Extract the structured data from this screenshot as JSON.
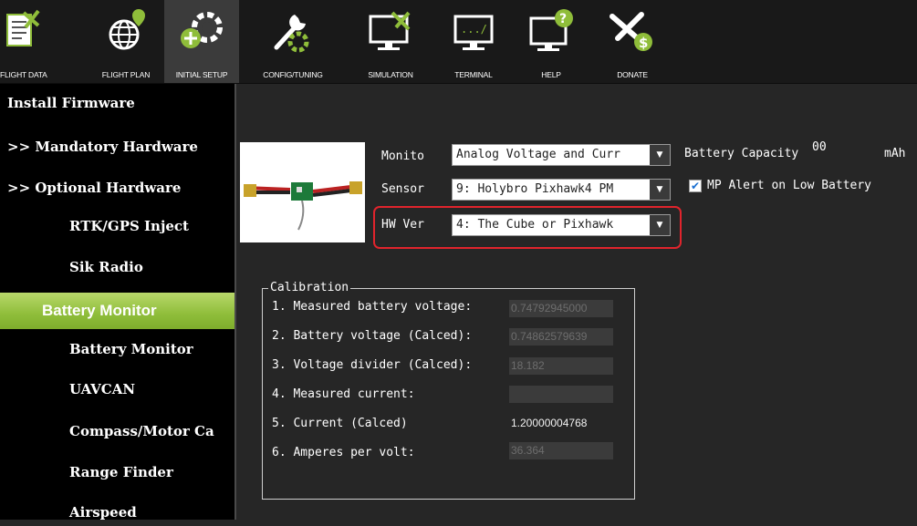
{
  "toolbar": {
    "buttons": [
      {
        "label": "FLIGHT DATA",
        "icon": "flight-data-icon"
      },
      {
        "label": "FLIGHT PLAN",
        "icon": "flight-plan-icon"
      },
      {
        "label": "INITIAL SETUP",
        "icon": "initial-setup-icon",
        "active": true
      },
      {
        "label": "CONFIG/TUNING",
        "icon": "config-tuning-icon"
      },
      {
        "label": "SIMULATION",
        "icon": "simulation-icon"
      },
      {
        "label": "TERMINAL",
        "icon": "terminal-icon"
      },
      {
        "label": "HELP",
        "icon": "help-icon"
      },
      {
        "label": "DONATE",
        "icon": "donate-icon"
      }
    ]
  },
  "sidebar": {
    "items": [
      {
        "label": "Install Firmware"
      },
      {
        "label": ">> Mandatory Hardware"
      },
      {
        "label": ">> Optional Hardware"
      },
      {
        "label": "RTK/GPS Inject"
      },
      {
        "label": "Sik Radio"
      },
      {
        "label": "Battery Monitor"
      },
      {
        "label": "Battery Monitor"
      },
      {
        "label": "UAVCAN"
      },
      {
        "label": "Compass/Motor Ca"
      },
      {
        "label": "Range Finder"
      },
      {
        "label": "Airspeed"
      }
    ]
  },
  "battery": {
    "monitor_label": "Monito",
    "monitor_value": "Analog Voltage and Curr",
    "sensor_label": "Sensor",
    "sensor_value": "9: Holybro Pixhawk4 PM",
    "hwver_label": "HW Ver",
    "hwver_value": "4: The Cube or Pixhawk",
    "capacity_label": "Battery Capacity",
    "capacity_value": "00",
    "capacity_unit": "mAh",
    "alert_label": "MP Alert on Low Battery",
    "alert_checked": true
  },
  "calibration": {
    "title": "Calibration",
    "rows": [
      {
        "label": "1. Measured battery voltage:",
        "value": "0.74792945000"
      },
      {
        "label": "2. Battery voltage (Calced):",
        "value": "0.74862579639"
      },
      {
        "label": "3. Voltage divider (Calced):",
        "value": "18.182"
      },
      {
        "label": "4. Measured current:",
        "value": ""
      },
      {
        "label": "5. Current (Calced)",
        "value": "1.20000004768"
      },
      {
        "label": "6. Amperes per volt:",
        "value": "36.364"
      }
    ]
  },
  "colors": {
    "accent_green": "#8fbd3a",
    "highlight_red": "#e0242c"
  }
}
